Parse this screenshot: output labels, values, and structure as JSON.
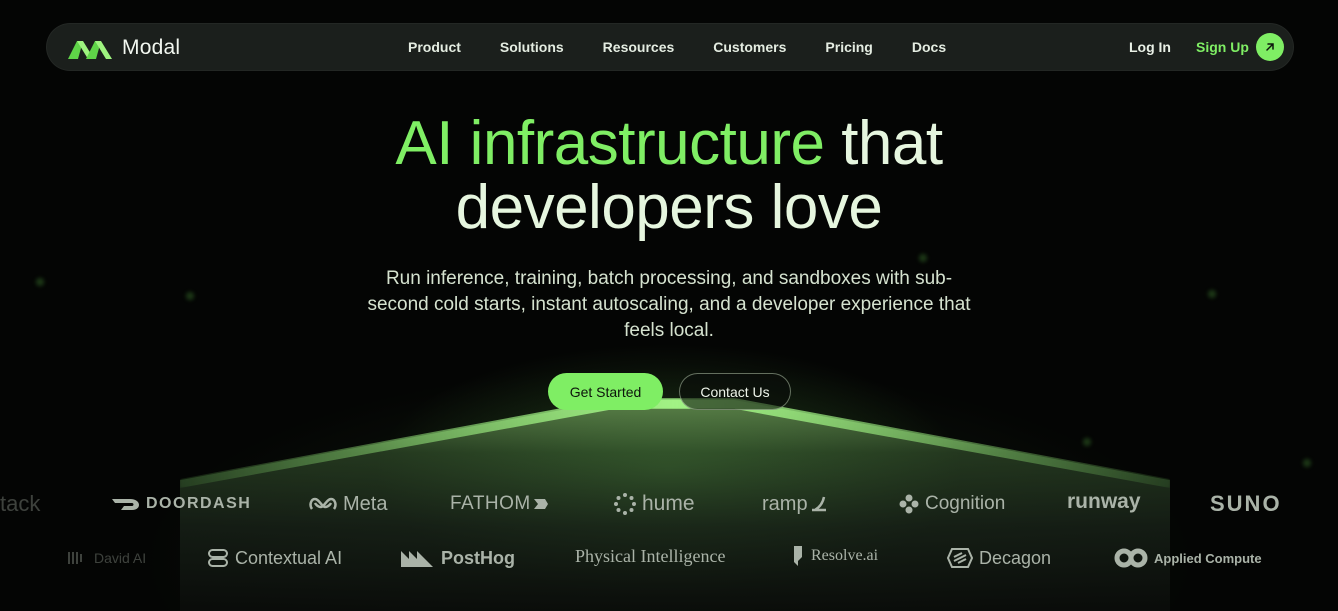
{
  "brand": {
    "name": "Modal",
    "accent": "#7fee64"
  },
  "nav": {
    "links": [
      "Product",
      "Solutions",
      "Resources",
      "Customers",
      "Pricing",
      "Docs"
    ],
    "login": "Log In",
    "signup": "Sign Up",
    "signup_icon": "arrow-up-right-icon"
  },
  "hero": {
    "headline_accent": "AI infrastructure",
    "headline_rest1": " that",
    "headline_line2": "developers love",
    "subtext": "Run inference, training, batch processing, and sandboxes with sub-second cold starts, instant autoscaling, and a developer experience that feels local.",
    "primary_cta": "Get Started",
    "secondary_cta": "Contact Us"
  },
  "customers": {
    "row1": [
      "tack",
      "DOORDASH",
      "Meta",
      "FATHOM",
      "hume",
      "ramp",
      "Cognition",
      "runway",
      "SUNO"
    ],
    "row2": [
      "David AI",
      "Contextual AI",
      "PostHog",
      "Physical Intelligence",
      "Resolve.ai",
      "Decagon",
      "Applied Compute"
    ]
  }
}
